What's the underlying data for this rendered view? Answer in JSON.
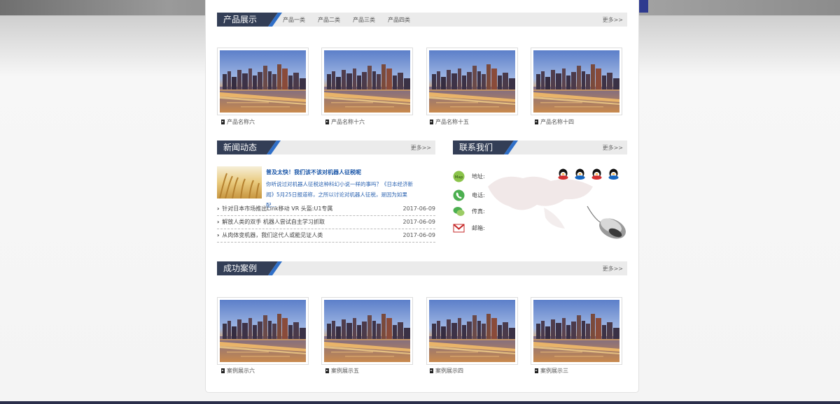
{
  "products": {
    "title": "产品展示",
    "more": "更多>>",
    "tabs": [
      "产品一类",
      "产品二类",
      "产品三类",
      "产品四类"
    ],
    "items": [
      "产品名称六",
      "产品名称十六",
      "产品名称十五",
      "产品名称十四"
    ]
  },
  "news": {
    "title": "新闻动态",
    "more": "更多>>",
    "featured": {
      "title": "普及太快！我们该不该对机器人征税呢",
      "desc": "你听说过对机器人征税这种科幻小说一样的事吗？《日本经济新闻》5月25日报道称，之所以讨论对机器人征税，是因为如果配…"
    },
    "list": [
      {
        "title": "针对日本市场推出Link移动 VR 头盔:U1专属",
        "date": "2017-06-09"
      },
      {
        "title": "解放人类的双手 机器人尝试自主学习抓取",
        "date": "2017-06-09"
      },
      {
        "title": "从肉体变机器，我们这代人或能见证人类",
        "date": "2017-06-09"
      }
    ]
  },
  "contact": {
    "title": "联系我们",
    "more": "更多>>",
    "address_label": "地址:",
    "phone_label": "电话:",
    "fax_label": "传真:",
    "email_label": "邮箱:",
    "map_icon_text": "Map"
  },
  "cases": {
    "title": "成功案例",
    "more": "更多>>",
    "items": [
      "案例展示六",
      "案例展示五",
      "案例展示四",
      "案例展示三"
    ]
  },
  "colors": {
    "header_dark": "#333e56",
    "header_stripe": "#2f6fc8",
    "link_blue": "#1a56a8"
  }
}
